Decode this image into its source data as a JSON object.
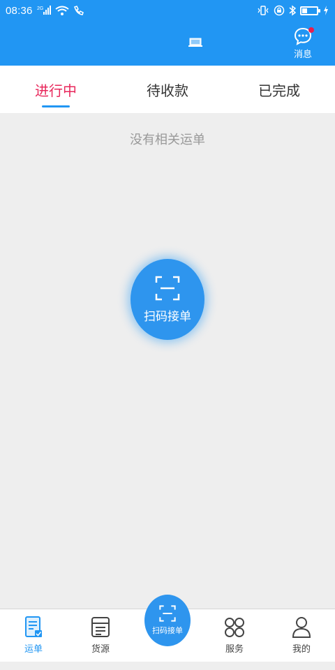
{
  "status_bar": {
    "time": "08:36",
    "network": "2G"
  },
  "header": {
    "message_label": "消息"
  },
  "tabs": [
    {
      "label": "进行中",
      "active": true
    },
    {
      "label": "待收款",
      "active": false
    },
    {
      "label": "已完成",
      "active": false
    }
  ],
  "content": {
    "empty_text": "没有相关运单"
  },
  "scan_button": {
    "label": "扫码接单"
  },
  "bottom_nav": {
    "items": [
      {
        "label": "运单",
        "icon": "waybill-icon",
        "active": true
      },
      {
        "label": "货源",
        "icon": "cargo-source-icon",
        "active": false
      },
      {
        "label": "扫码接单",
        "icon": "scan-icon",
        "active": false
      },
      {
        "label": "服务",
        "icon": "services-icon",
        "active": false
      },
      {
        "label": "我的",
        "icon": "profile-icon",
        "active": false
      }
    ]
  },
  "colors": {
    "brand_blue": "#2196f3",
    "active_tab_red": "#e8275b",
    "notification_dot": "#e91e4d"
  }
}
